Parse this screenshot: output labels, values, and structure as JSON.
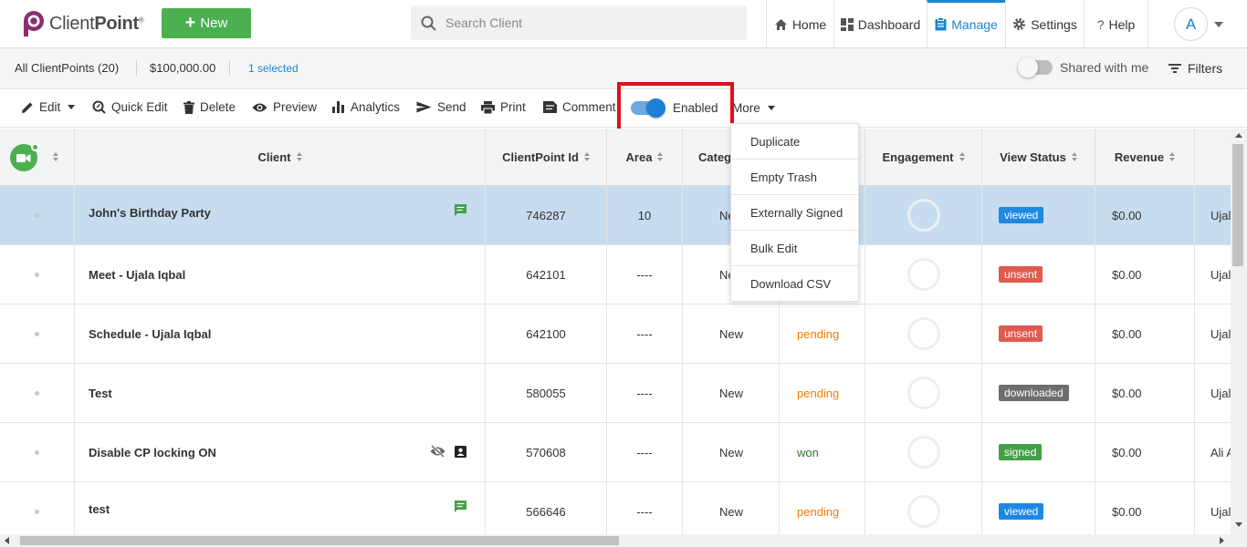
{
  "brand": {
    "name_light": "Client",
    "name_bold": "Point",
    "reg": "®"
  },
  "new_button": {
    "label": "New"
  },
  "search": {
    "placeholder": "Search Client",
    "value": ""
  },
  "nav": [
    {
      "label": "Home",
      "icon": "home-icon"
    },
    {
      "label": "Dashboard",
      "icon": "dashboard-icon"
    },
    {
      "label": "Manage",
      "icon": "clipboard-icon",
      "active": true
    },
    {
      "label": "Settings",
      "icon": "gear-icon"
    },
    {
      "label": "Help",
      "icon": "question-icon"
    }
  ],
  "user": {
    "initial": "A"
  },
  "subbar": {
    "all_label": "All ClientPoints (20)",
    "total": "$100,000.00",
    "selected": "1 selected",
    "shared_label": "Shared with me",
    "filters_label": "Filters"
  },
  "toolbar": {
    "edit": "Edit",
    "quick_edit": "Quick Edit",
    "delete": "Delete",
    "preview": "Preview",
    "analytics": "Analytics",
    "send": "Send",
    "print": "Print",
    "comment": "Comment",
    "enabled": "Enabled",
    "more": "More"
  },
  "more_menu": [
    "Duplicate",
    "Empty Trash",
    "Externally Signed",
    "Bulk Edit",
    "Download CSV"
  ],
  "columns": {
    "client": "Client",
    "clientpoint_id": "ClientPoint Id",
    "area": "Area",
    "category": "Categ",
    "engagement": "Engagement",
    "view_status": "View Status",
    "revenue": "Revenue"
  },
  "rows": [
    {
      "client": "John's Birthday Party",
      "id": "746287",
      "area": "10",
      "category": "Ne",
      "status": "",
      "view_status": "viewed",
      "revenue": "$0.00",
      "owner": "Ujal",
      "selected": true
    },
    {
      "client": "Meet - Ujala Iqbal",
      "id": "642101",
      "area": "----",
      "category": "Ne",
      "status": "",
      "view_status": "unsent",
      "revenue": "$0.00",
      "owner": "Ujal"
    },
    {
      "client": "Schedule - Ujala Iqbal",
      "id": "642100",
      "area": "----",
      "category": "New",
      "status": "pending",
      "view_status": "unsent",
      "revenue": "$0.00",
      "owner": "Ujal"
    },
    {
      "client": "Test",
      "id": "580055",
      "area": "----",
      "category": "New",
      "status": "pending",
      "view_status": "downloaded",
      "revenue": "$0.00",
      "owner": "Ujal"
    },
    {
      "client": "Disable CP locking ON",
      "id": "570608",
      "area": "----",
      "category": "New",
      "status": "won",
      "view_status": "signed",
      "revenue": "$0.00",
      "owner": "Ali A"
    },
    {
      "client": "test",
      "id": "566646",
      "area": "----",
      "category": "New",
      "status": "pending",
      "view_status": "viewed",
      "revenue": "$0.00",
      "owner": "Ujal"
    }
  ],
  "colors": {
    "brand_purple": "#8b2f6e",
    "primary_blue": "#1a86d0",
    "new_green": "#4caf50",
    "highlight_red": "#e0101b",
    "viewed": "#1e88e5",
    "unsent": "#e05a4f",
    "downloaded": "#6d6d6d",
    "signed": "#43a047",
    "pending": "#f57c00",
    "won": "#2e7d32"
  }
}
